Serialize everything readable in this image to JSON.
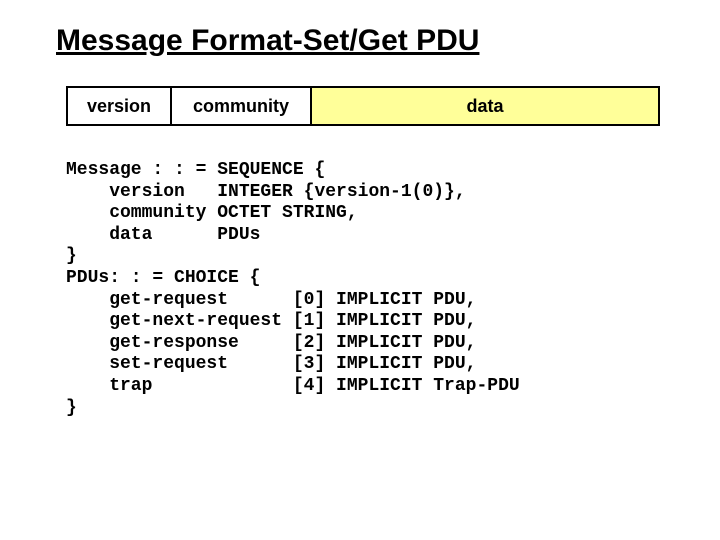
{
  "title": "Message Format-Set/Get PDU",
  "table": {
    "version": "version",
    "community": "community",
    "data": "data"
  },
  "asn1": {
    "l1": "Message : : = SEQUENCE {",
    "l2": "    version   INTEGER {version-1(0)},",
    "l3": "    community OCTET STRING,",
    "l4": "    data      PDUs",
    "l5": "}",
    "l6": "PDUs: : = CHOICE {",
    "l7": "    get-request      [0] IMPLICIT PDU,",
    "l8": "    get-next-request [1] IMPLICIT PDU,",
    "l9": "    get-response     [2] IMPLICIT PDU,",
    "l10": "    set-request      [3] IMPLICIT PDU,",
    "l11": "    trap             [4] IMPLICIT Trap-PDU",
    "l12": "}"
  }
}
